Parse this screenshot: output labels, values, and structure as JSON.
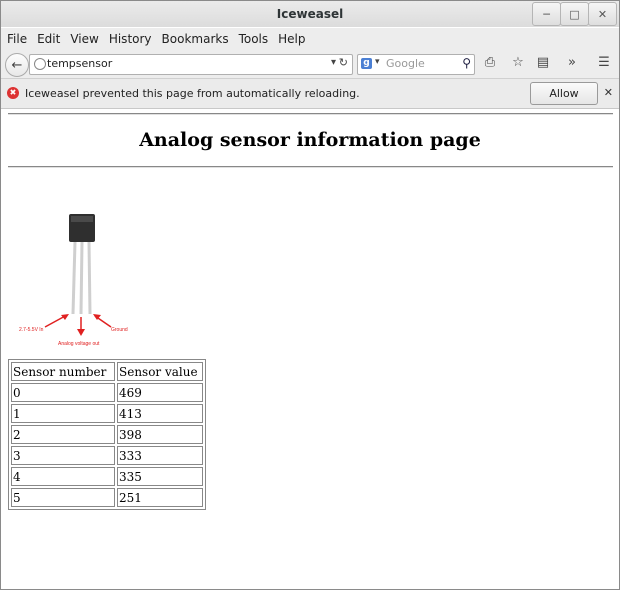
{
  "window": {
    "title": "Iceweasel"
  },
  "menu": [
    "File",
    "Edit",
    "View",
    "History",
    "Bookmarks",
    "Tools",
    "Help"
  ],
  "nav": {
    "url": "tempsensor",
    "search_placeholder": "Google"
  },
  "notification": {
    "text": "Iceweasel prevented this page from automatically reloading.",
    "allow_label": "Allow"
  },
  "page": {
    "heading": "Analog sensor information page",
    "image_labels": {
      "left": "2.7-5.5V In",
      "center": "Analog voltage out",
      "right": "Ground"
    },
    "table": {
      "headers": [
        "Sensor number",
        "Sensor value"
      ],
      "rows": [
        [
          "0",
          "469"
        ],
        [
          "1",
          "413"
        ],
        [
          "2",
          "398"
        ],
        [
          "3",
          "333"
        ],
        [
          "4",
          "335"
        ],
        [
          "5",
          "251"
        ]
      ]
    }
  },
  "colors": {
    "arrow_red": "#e02020",
    "component_black": "#333333"
  }
}
